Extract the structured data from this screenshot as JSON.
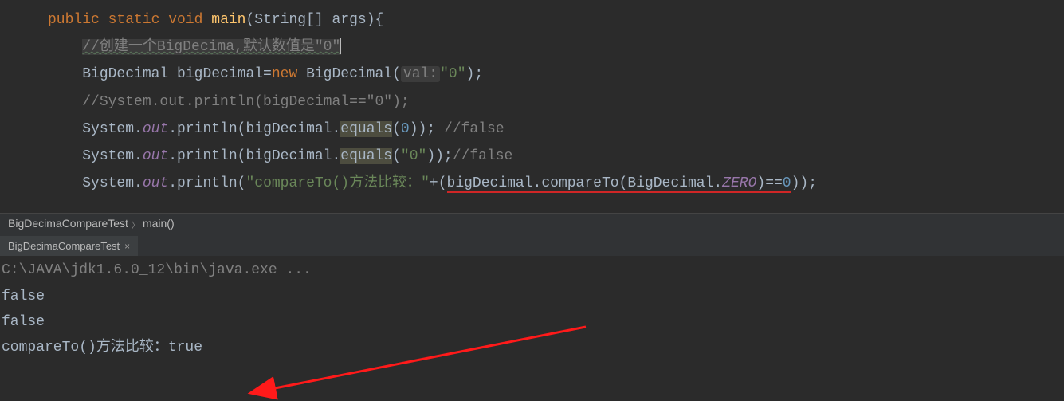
{
  "code": {
    "l1": {
      "kw1": "public",
      "kw2": "static",
      "kw3": "void",
      "fn": "main",
      "p1": "(String[] args){"
    },
    "l2": {
      "cm": "//创建一个BigDecima,默认数值是\"0\""
    },
    "l3": {
      "a": "BigDecimal bigDecimal=",
      "kw": "new",
      "b": " BigDecimal(",
      "hint": "val:",
      "s": "\"0\"",
      "c": ");"
    },
    "l4": {
      "cm": "//System.out.println(bigDecimal==\"0\");"
    },
    "l5": {
      "a": "System.",
      "o": "out",
      "b": ".println(bigDecimal.",
      "m": "equals",
      "c": "(",
      "n": "0",
      "d": ")); ",
      "cm": "//false"
    },
    "l6": {
      "a": "System.",
      "o": "out",
      "b": ".println(bigDecimal.",
      "m": "equals",
      "c": "(",
      "s": "\"0\"",
      "d": "));",
      "cm": "//false"
    },
    "l7": {
      "a": "System.",
      "o": "out",
      "b": ".println(",
      "s": "\"compareTo()方法比较：\"",
      "c": "+(",
      "u": "bigDecimal.compareTo(BigDecimal.",
      "z": "ZERO",
      "e": ")==",
      "n": "0",
      "f": "));"
    }
  },
  "breadcrumb": {
    "a": "BigDecimaCompareTest",
    "b": "main()"
  },
  "tab": {
    "name": "BigDecimaCompareTest",
    "close": "×"
  },
  "console": {
    "cmd": "C:\\JAVA\\jdk1.6.0_12\\bin\\java.exe ...",
    "l1": "false",
    "l2": "false",
    "l3": "compareTo()方法比较：true"
  }
}
